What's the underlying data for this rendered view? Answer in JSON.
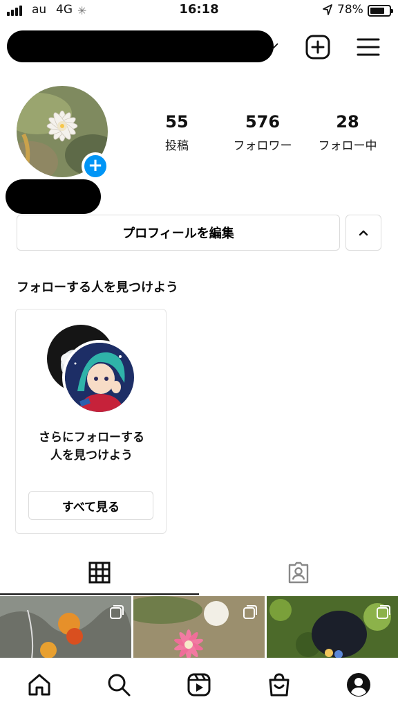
{
  "status_bar": {
    "carrier": "au",
    "network": "4G",
    "time": "16:18",
    "battery_percent": "78%",
    "battery_level": 0.78,
    "icons": [
      "signal-icon",
      "loading-spinner-icon",
      "location-arrow-icon",
      "battery-icon"
    ]
  },
  "header": {
    "icons": [
      "new-post-plus-icon",
      "hamburger-menu-icon"
    ]
  },
  "profile": {
    "stats": [
      {
        "value": "55",
        "label": "投稿"
      },
      {
        "value": "576",
        "label": "フォロワー"
      },
      {
        "value": "28",
        "label": "フォロー中"
      }
    ],
    "add_story_icon": "+",
    "edit_button": "プロフィールを編集",
    "toggle_icon": "chevron-up-icon"
  },
  "suggestions": {
    "title": "フォローする人を見つけよう",
    "card": {
      "line1": "さらにフォローする",
      "line2": "人を見つけよう",
      "button": "すべて見る"
    }
  },
  "tabs": {
    "items": [
      "grid-icon",
      "tagged-person-icon"
    ],
    "active": 0
  },
  "bottom_nav": {
    "items": [
      "home-icon",
      "search-icon",
      "reels-icon",
      "shop-icon",
      "profile-icon"
    ]
  },
  "colors": {
    "accent": "#0095f6",
    "border": "#dbdbdb",
    "text": "#111111"
  }
}
